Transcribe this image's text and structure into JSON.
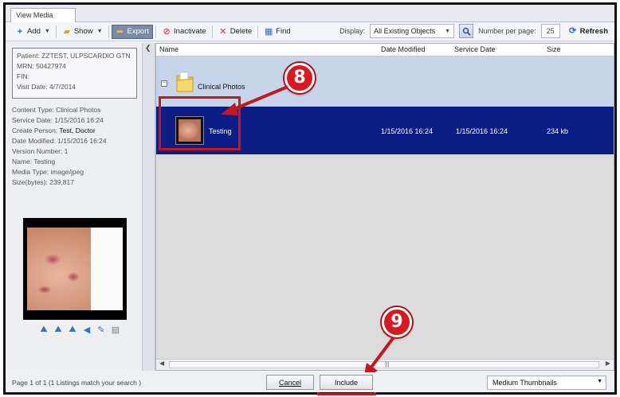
{
  "window": {
    "tab_title": "View Media"
  },
  "toolbar": {
    "add_label": "Add",
    "show_label": "Show",
    "export_label": "Export",
    "inactivate_label": "Inactivate",
    "delete_label": "Delete",
    "find_label": "Find",
    "display_label": "Display:",
    "display_value": "All Existing Objects",
    "per_page_label": "Number per page:",
    "per_page_value": "25",
    "refresh_label": "Refresh"
  },
  "patient": {
    "patient": "Patient:  ZZTEST, ULPSCARDIO GTN",
    "mrn": "MRN:  50427974",
    "fin": "FIN:",
    "visit_date": "Visit Date:  4/7/2014"
  },
  "details": {
    "content_type": "Content Type:  Clinical Photos",
    "service_date": "Service Date:  1/15/2016 16:24",
    "create_person_label": "Create Person:",
    "create_person_value": "Test, Doctor",
    "date_modified": "Date Modified:  1/15/2016 16:24",
    "version_number": "Version Number:  1",
    "name": "Name:  Testing",
    "media_type": "Media Type:  image/jpeg",
    "size": "Size(bytes):  239,817"
  },
  "list": {
    "columns": [
      "Name",
      "Date Modified",
      "Service Date",
      "Size"
    ],
    "group_label": "Clinical Photos",
    "item": {
      "name": "Testing",
      "date_modified": "1/15/2016 16:24",
      "service_date": "1/15/2016 16:24",
      "size": "234 kb"
    }
  },
  "callouts": {
    "step8": "8",
    "step9": "9"
  },
  "bottom": {
    "status": "Page 1 of 1 (1 Listings match your search )",
    "cancel_label": "Cancel",
    "include_label": "Include",
    "view_mode": "Medium Thumbnails"
  },
  "colors": {
    "selected_row": "#0c1d86",
    "group_row": "#c6d5ea",
    "callout_red": "#c8161d"
  }
}
